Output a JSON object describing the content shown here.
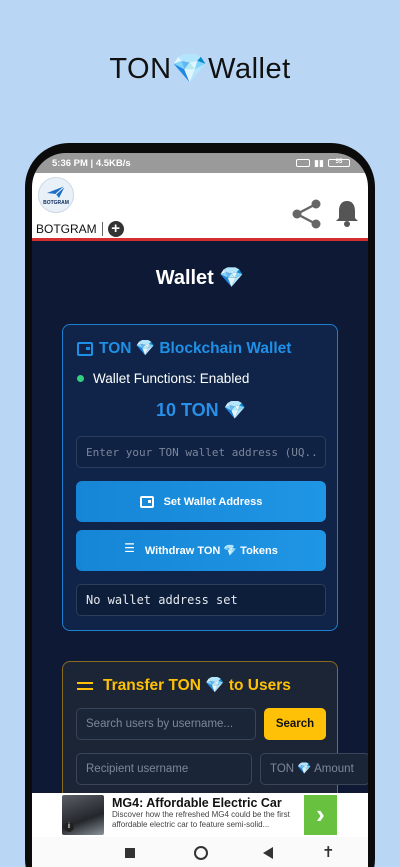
{
  "promo": {
    "title": "TON💎Wallet"
  },
  "status_bar": {
    "time_speed": "5:36 PM | 4.5KB/s",
    "battery": "55"
  },
  "header": {
    "logo_text": "BOTGRAM",
    "brand_name": "BOTGRAM",
    "add_label": "+"
  },
  "page": {
    "title": "Wallet 💎"
  },
  "wallet_card": {
    "title": "TON 💎 Blockchain Wallet",
    "status": "Wallet Functions: Enabled",
    "balance": "10 TON 💎",
    "address_placeholder": "Enter your TON wallet address (UQ...)",
    "set_address_label": "Set Wallet Address",
    "withdraw_label": "Withdraw TON 💎 Tokens",
    "address_display": "No wallet address set"
  },
  "transfer_card": {
    "title": "Transfer TON 💎 to Users",
    "search_placeholder": "Search users by username...",
    "search_label": "Search",
    "recipient_placeholder": "Recipient username",
    "amount_placeholder": "TON 💎 Amount"
  },
  "ad": {
    "title": "MG4: Affordable Electric Car",
    "description": "Discover how the refreshed MG4 could be the first affordable electric car to feature semi-solid...",
    "go_label": "›",
    "info_label": "i"
  },
  "nav": {
    "accessibility_label": "✝"
  },
  "colors": {
    "accent_blue": "#1e90e8",
    "accent_gold": "#ffc107",
    "status_green": "#35d07f",
    "header_divider": "#d32f2f"
  }
}
